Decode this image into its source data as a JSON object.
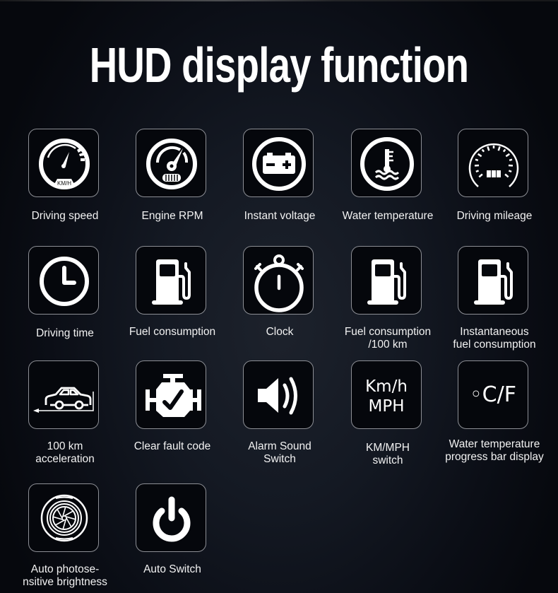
{
  "header": {
    "title": "HUD  display function"
  },
  "features": [
    {
      "id": "driving-speed",
      "icon": "speedometer-icon",
      "label": "Driving speed",
      "icon_text": "KM/H"
    },
    {
      "id": "engine-rpm",
      "icon": "tachometer-icon",
      "label": "Engine RPM"
    },
    {
      "id": "instant-voltage",
      "icon": "battery-icon",
      "label": "Instant voltage"
    },
    {
      "id": "water-temperature",
      "icon": "coolant-temperature-icon",
      "label": "Water temperature"
    },
    {
      "id": "driving-mileage",
      "icon": "odometer-icon",
      "label": "Driving mileage"
    },
    {
      "id": "driving-time",
      "icon": "clock-icon",
      "label": "Driving time"
    },
    {
      "id": "fuel-consumption",
      "icon": "fuel-pump-icon",
      "label": "Fuel consumption"
    },
    {
      "id": "clock",
      "icon": "stopwatch-icon",
      "label": "Clock"
    },
    {
      "id": "fuel-consumption-100km",
      "icon": "fuel-pump-icon",
      "label_lines": [
        "Fuel consumption",
        "/100 km"
      ]
    },
    {
      "id": "instantaneous-fuel-consumption",
      "icon": "fuel-pump-icon",
      "label_lines": [
        "Instantaneous",
        "fuel consumption"
      ]
    },
    {
      "id": "acceleration-100km",
      "icon": "car-acceleration-icon",
      "label_lines": [
        "100 km",
        "acceleration"
      ]
    },
    {
      "id": "clear-fault-code",
      "icon": "engine-check-icon",
      "label": "Clear fault code"
    },
    {
      "id": "alarm-sound-switch",
      "icon": "speaker-icon",
      "label_lines": [
        "Alarm Sound",
        "Switch"
      ]
    },
    {
      "id": "kmh-mph-switch",
      "icon": "unit-text-icon",
      "icon_text_lines": [
        "Km/h",
        "MPH"
      ],
      "label_lines": [
        "KM/MPH",
        "switch"
      ]
    },
    {
      "id": "water-temp-progress-bar",
      "icon": "celsius-fahrenheit-icon",
      "icon_text": "◦C/F",
      "label_lines": [
        "Water temperature",
        "progress bar display"
      ]
    },
    {
      "id": "auto-photosensitive-brightness",
      "icon": "light-sensor-icon",
      "label_lines": [
        "Auto photose-",
        "nsitive brightness"
      ]
    },
    {
      "id": "auto-switch",
      "icon": "power-icon",
      "label": "Auto Switch"
    }
  ]
}
